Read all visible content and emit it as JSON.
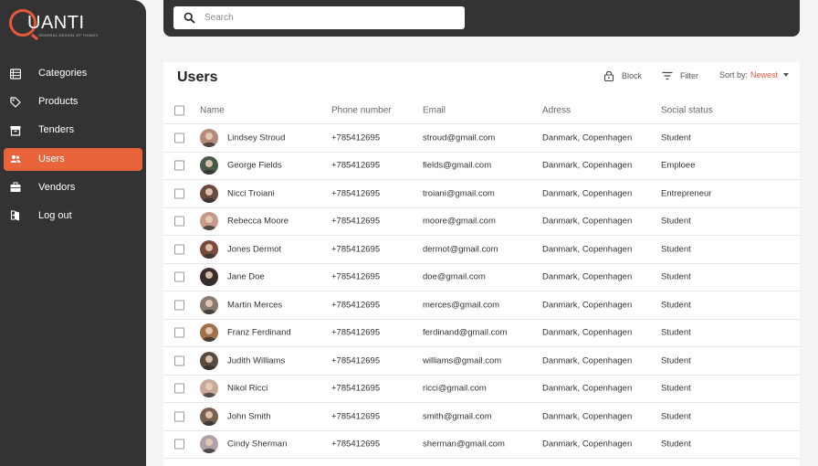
{
  "brand": {
    "name": "UANTI",
    "tagline": "GENERAL DESIGN OF THINGS"
  },
  "sidebar": {
    "items": [
      {
        "label": "Categories",
        "icon": "categories-icon",
        "active": false
      },
      {
        "label": "Products",
        "icon": "tag-icon",
        "active": false
      },
      {
        "label": "Tenders",
        "icon": "archive-icon",
        "active": false
      },
      {
        "label": "Users",
        "icon": "users-icon",
        "active": true
      },
      {
        "label": "Vendors",
        "icon": "briefcase-icon",
        "active": false
      },
      {
        "label": "Log out",
        "icon": "logout-icon",
        "active": false
      }
    ]
  },
  "search": {
    "placeholder": "Search",
    "value": ""
  },
  "page": {
    "title": "Users"
  },
  "toolbar": {
    "block_label": "Block",
    "filter_label": "Filter",
    "sort_label": "Sort by:",
    "sort_value": "Newest"
  },
  "table": {
    "headers": {
      "name": "Name",
      "phone": "Phone number",
      "email": "Email",
      "address": "Adress",
      "status": "Social status"
    },
    "rows": [
      {
        "name": "Lindsey Stroud",
        "phone": "+785412695",
        "email": "stroud@gmail.com",
        "address": "Danmark, Copenhagen",
        "status": "Student",
        "avatar_color": "#b48a7a"
      },
      {
        "name": "George Fields",
        "phone": "+785412695",
        "email": "fields@gmail.com",
        "address": "Danmark, Copenhagen",
        "status": "Emploee",
        "avatar_color": "#4a5a4a"
      },
      {
        "name": "Nicci Troiani",
        "phone": "+785412695",
        "email": "troiani@gmail.com",
        "address": "Danmark, Copenhagen",
        "status": "Entrepreneur",
        "avatar_color": "#6b4a3e"
      },
      {
        "name": "Rebecca Moore",
        "phone": "+785412695",
        "email": "moore@gmail.com",
        "address": "Danmark, Copenhagen",
        "status": "Student",
        "avatar_color": "#c59a8a"
      },
      {
        "name": "Jones Dermot",
        "phone": "+785412695",
        "email": "dermot@gmail.com",
        "address": "Danmark, Copenhagen",
        "status": "Student",
        "avatar_color": "#7a4a3a"
      },
      {
        "name": "Jane Doe",
        "phone": "+785412695",
        "email": "doe@gmail.com",
        "address": "Danmark, Copenhagen",
        "status": "Student",
        "avatar_color": "#3a2e2a"
      },
      {
        "name": "Martin Merces",
        "phone": "+785412695",
        "email": "merces@gmail.com",
        "address": "Danmark, Copenhagen",
        "status": "Student",
        "avatar_color": "#8a7a70"
      },
      {
        "name": "Franz Ferdinand",
        "phone": "+785412695",
        "email": "ferdinand@gmail.com",
        "address": "Danmark, Copenhagen",
        "status": "Student",
        "avatar_color": "#a0704a"
      },
      {
        "name": "Judith Williams",
        "phone": "+785412695",
        "email": "williams@gmail.com",
        "address": "Danmark, Copenhagen",
        "status": "Student",
        "avatar_color": "#5a4a40"
      },
      {
        "name": "Nikol Ricci",
        "phone": "+785412695",
        "email": "ricci@gmail.com",
        "address": "Danmark, Copenhagen",
        "status": "Student",
        "avatar_color": "#c8a898"
      },
      {
        "name": "John Smith",
        "phone": "+785412695",
        "email": "smith@gmail.com",
        "address": "Danmark, Copenhagen",
        "status": "Student",
        "avatar_color": "#7a6050"
      },
      {
        "name": "Cindy Sherman",
        "phone": "+785412695",
        "email": "sherman@gmail.com",
        "address": "Danmark, Copenhagen",
        "status": "Student",
        "avatar_color": "#b0a0a8"
      }
    ]
  },
  "colors": {
    "accent": "#e9643b",
    "sidebar_bg": "#333333",
    "page_bg": "#f4f4f4"
  }
}
